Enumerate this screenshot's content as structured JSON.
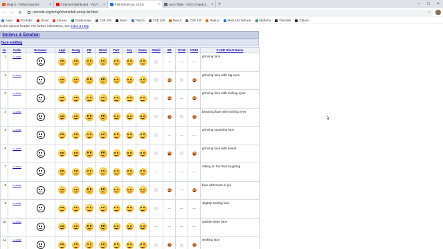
{
  "browser": {
    "tabs": [
      {
        "title": "Repl.it - Pythoncourse3",
        "color": "#f26207"
      },
      {
        "title": "Channel dashboard - YouTube Studio",
        "color": "#ff0000"
      },
      {
        "title": "Full Emoji List, v13.0",
        "color": "#1a73e8",
        "active": true
      },
      {
        "title": "Ascii Table - ASCII character codes",
        "color": "#5f6b7a"
      }
    ],
    "close_glyph": "×",
    "new_tab_glyph": "+",
    "window_controls": [
      "–",
      "□",
      "×"
    ],
    "back_glyph": "←",
    "forward_glyph": "→",
    "reload_glyph": "⟳",
    "url": "unicode.org/emoji/charts/full-emoji-list.html",
    "star_glyph": "☆",
    "bookmarks": [
      {
        "label": "Apps",
        "color": "#4285f4"
      },
      {
        "label": "YouTube",
        "color": "#ff0000"
      },
      {
        "label": "Gmail",
        "color": "#d93025"
      },
      {
        "label": "Canvas",
        "color": "#e13f2b"
      },
      {
        "label": "Gradescope",
        "color": "#0f9d58"
      },
      {
        "label": "CSE 100",
        "color": "#5f6368"
      },
      {
        "label": "Ilearn",
        "color": "#202124"
      },
      {
        "label": "Piazza",
        "color": "#3a7bd5"
      },
      {
        "label": "CSE 105",
        "color": "#5f6368"
      },
      {
        "label": "Repl.it",
        "color": "#f26207"
      },
      {
        "label": "CSE 105",
        "color": "#5f6368"
      },
      {
        "label": "Repl.js",
        "color": "#f26207"
      },
      {
        "label": "Math 183 Tetbook",
        "color": "#1a73e8"
      },
      {
        "label": "Mathcha",
        "color": "#34a853"
      },
      {
        "label": "Tritonlink",
        "color": "#182b49"
      },
      {
        "label": "GitHub",
        "color": "#24292e"
      }
    ]
  },
  "page": {
    "notice_text": "in the column header. For further information, see",
    "notice_link": "Index & Help",
    "section_title": "Smileys & Emotion",
    "subsection_title": "face-smiling",
    "columns": [
      "№",
      "Code",
      "Browser",
      "Appl",
      "Goog",
      "FB",
      "Wind",
      "Twtr",
      "Joy",
      "Sams",
      "GMail",
      "SB",
      "DCM",
      "KDDI",
      "CLDR Short Name"
    ],
    "na_glyph": "—",
    "rows": [
      {
        "num": "1",
        "code": "U+1F600",
        "name": "grinning face",
        "cells": [
          "e",
          "e",
          "e",
          "e",
          "e",
          "e",
          "e",
          "x",
          "n",
          "n",
          "n"
        ]
      },
      {
        "num": "2",
        "code": "U+1F603",
        "name": "grinning face with big eyes",
        "cells": [
          "e",
          "e",
          "e",
          "e",
          "e",
          "e",
          "e",
          "x",
          "d",
          "x",
          "d"
        ]
      },
      {
        "num": "3",
        "code": "U+1F604",
        "name": "grinning face with smiling eyes",
        "cells": [
          "e",
          "e",
          "e",
          "e",
          "e",
          "e",
          "e",
          "x",
          "d",
          "n",
          "d"
        ]
      },
      {
        "num": "4",
        "code": "U+1F601",
        "name": "beaming face with smiling eyes",
        "cells": [
          "e",
          "e",
          "e",
          "e",
          "e",
          "e",
          "e",
          "x",
          "d",
          "x",
          "d"
        ]
      },
      {
        "num": "5",
        "code": "U+1F606",
        "name": "grinning squinting face",
        "cells": [
          "e",
          "e",
          "e",
          "e",
          "e",
          "e",
          "e",
          "x",
          "n",
          "n",
          "n"
        ]
      },
      {
        "num": "6",
        "code": "U+1F605",
        "name": "grinning face with sweat",
        "cells": [
          "e",
          "e",
          "e",
          "e",
          "e",
          "e",
          "e",
          "x",
          "d",
          "x",
          "d"
        ]
      },
      {
        "num": "7",
        "code": "U+1F923",
        "name": "rolling on the floor laughing",
        "cells": [
          "e",
          "e",
          "e",
          "e",
          "e",
          "e",
          "e",
          "n",
          "n",
          "n",
          "n"
        ]
      },
      {
        "num": "8",
        "code": "U+1F602",
        "name": "face with tears of joy",
        "cells": [
          "e",
          "e",
          "e",
          "e",
          "e",
          "e",
          "e",
          "x",
          "d",
          "n",
          "d"
        ]
      },
      {
        "num": "9",
        "code": "U+1F642",
        "name": "slightly smiling face",
        "cells": [
          "e",
          "e",
          "e",
          "e",
          "e",
          "e",
          "e",
          "x",
          "n",
          "n",
          "n"
        ]
      },
      {
        "num": "10",
        "code": "U+1F643",
        "name": "upside-down face",
        "cells": [
          "e",
          "e",
          "e",
          "e",
          "e",
          "e",
          "e",
          "n",
          "n",
          "n",
          "n"
        ]
      },
      {
        "num": "11",
        "code": "U+1F609",
        "name": "winking face",
        "cells": [
          "e",
          "e",
          "e",
          "e",
          "e",
          "e",
          "e",
          "x",
          "d",
          "x",
          "d"
        ]
      }
    ]
  }
}
